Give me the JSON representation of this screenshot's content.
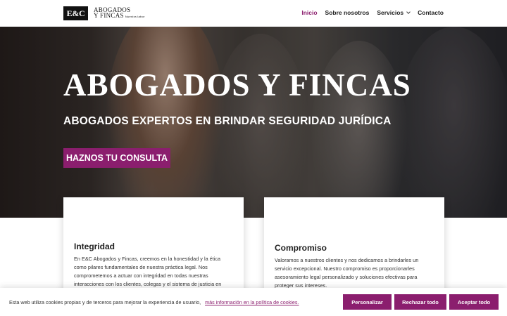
{
  "brand": {
    "logo_mark": "E&C",
    "logo_line1": "ABOGADOS",
    "logo_line2": "Y FINCAS",
    "logo_line3": "Nuestra labor"
  },
  "nav": {
    "items": [
      {
        "label": "Inicio",
        "active": true
      },
      {
        "label": "Sobre nosotros",
        "active": false
      },
      {
        "label": "Servicios",
        "active": false,
        "dropdown": true
      },
      {
        "label": "Contacto",
        "active": false
      }
    ]
  },
  "hero": {
    "title": "ABOGADOS Y FINCAS",
    "subtitle": "ABOGADOS EXPERTOS EN BRINDAR SEGURIDAD JURÍDICA",
    "cta_label": "HAZNOS TU CONSULTA"
  },
  "cards": [
    {
      "title": "Integridad",
      "text": "En E&C Abogados y Fincas, creemos en la honestidad y la ética como pilares fundamentales de nuestra práctica legal. Nos comprometemos a actuar con integridad en todas nuestras interacciones con los clientes, colegas y el sistema de justicia en general."
    },
    {
      "title": "Compromiso",
      "text": "Valoramos a nuestros clientes y nos dedicamos a brindarles un servicio excepcional. Nuestro compromiso es proporcionarles asesoramiento legal personalizado y soluciones efectivas para proteger sus intereses."
    }
  ],
  "cookie": {
    "text": "Esta web utiliza cookies propias y de terceros para mejorar la experiencia de usuario,",
    "link": "más información en la política de cookies.",
    "btn_customize": "Personalizar",
    "btn_reject": "Rechazar todo",
    "btn_accept": "Aceptar todo"
  },
  "colors": {
    "accent": "#8b1e6e",
    "text": "#222222"
  }
}
